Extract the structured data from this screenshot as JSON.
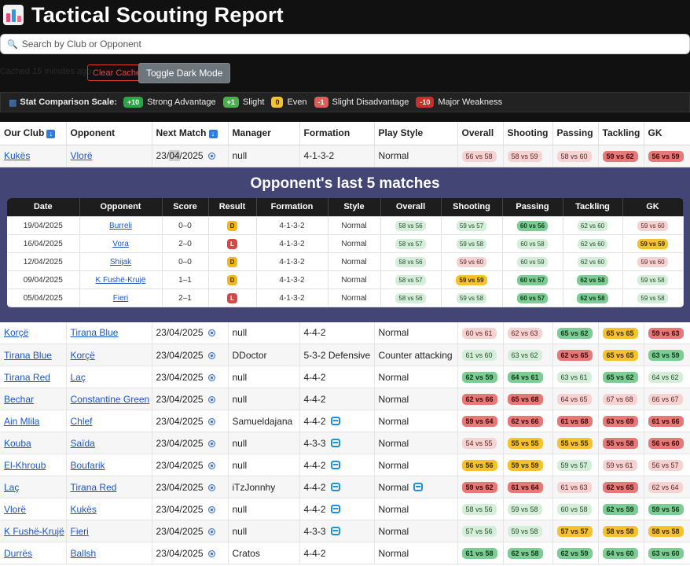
{
  "app": {
    "title": "Tactical Scouting Report",
    "search_placeholder": "Search by Club or Opponent",
    "cache_text": "Cached 15 minutes ago",
    "clear_cache_label": "Clear Cache",
    "toggle_dark_label": "Toggle Dark Mode"
  },
  "legend": {
    "label": "Stat Comparison Scale:",
    "items": [
      {
        "badge": "+10",
        "text": "Strong Advantage",
        "color": "#28a745"
      },
      {
        "badge": "+1",
        "text": "Slight",
        "color": "#4cae4c"
      },
      {
        "badge": "0",
        "text": "Even",
        "color": "#f6c22c"
      },
      {
        "badge": "-1",
        "text": "Slight Disadvantage",
        "color": "#e25b5b"
      },
      {
        "badge": "-10",
        "text": "Major Weakness",
        "color": "#c9302c"
      }
    ]
  },
  "table": {
    "headers": [
      "Our Club",
      "Opponent",
      "Next Match",
      "Manager",
      "Formation",
      "Play Style",
      "Overall",
      "Shooting",
      "Passing",
      "Tackling",
      "GK"
    ],
    "first_row": {
      "club": "Kukës",
      "opponent": "Vlorë",
      "date_a": "23/",
      "date_hl": "04",
      "date_b": "/2025",
      "manager": "null",
      "formation": "4-1-3-2",
      "style": "Normal",
      "stats": [
        {
          "t": "56 vs 58",
          "c": "p"
        },
        {
          "t": "58 vs 59",
          "c": "p"
        },
        {
          "t": "58 vs 60",
          "c": "p"
        },
        {
          "t": "59 vs 62",
          "c": "r"
        },
        {
          "t": "56 vs 59",
          "c": "r"
        }
      ]
    },
    "rows": [
      {
        "club": "Korçë",
        "opponent": "Tirana Blue",
        "date": "23/04/2025",
        "manager": "null",
        "formation": "4-4-2",
        "fswap": false,
        "style": "Normal",
        "sswap": false,
        "stats": [
          {
            "t": "60 vs 61",
            "c": "p"
          },
          {
            "t": "62 vs 63",
            "c": "p"
          },
          {
            "t": "65 vs 62",
            "c": "vg"
          },
          {
            "t": "65 vs 65",
            "c": "y"
          },
          {
            "t": "59 vs 63",
            "c": "r"
          }
        ]
      },
      {
        "club": "Tirana Blue",
        "opponent": "Korçë",
        "date": "23/04/2025",
        "manager": "DDoctor",
        "formation": "5-3-2 Defensive",
        "fswap": false,
        "style": "Counter attacking",
        "sswap": false,
        "stats": [
          {
            "t": "61 vs 60",
            "c": "g"
          },
          {
            "t": "63 vs 62",
            "c": "g"
          },
          {
            "t": "62 vs 65",
            "c": "r"
          },
          {
            "t": "65 vs 65",
            "c": "y"
          },
          {
            "t": "63 vs 59",
            "c": "vg"
          }
        ]
      },
      {
        "club": "Tirana Red",
        "opponent": "Laç",
        "date": "23/04/2025",
        "manager": "null",
        "formation": "4-4-2",
        "fswap": false,
        "style": "Normal",
        "sswap": false,
        "stats": [
          {
            "t": "62 vs 59",
            "c": "vg"
          },
          {
            "t": "64 vs 61",
            "c": "vg"
          },
          {
            "t": "63 vs 61",
            "c": "g"
          },
          {
            "t": "65 vs 62",
            "c": "vg"
          },
          {
            "t": "64 vs 62",
            "c": "g"
          }
        ]
      },
      {
        "club": "Bechar",
        "opponent": "Constantine Green",
        "date": "23/04/2025",
        "manager": "null",
        "formation": "4-4-2",
        "fswap": false,
        "style": "Normal",
        "sswap": false,
        "stats": [
          {
            "t": "62 vs 66",
            "c": "r"
          },
          {
            "t": "65 vs 68",
            "c": "r"
          },
          {
            "t": "64 vs 65",
            "c": "p"
          },
          {
            "t": "67 vs 68",
            "c": "p"
          },
          {
            "t": "66 vs 67",
            "c": "p"
          }
        ]
      },
      {
        "club": "Ain Mlila",
        "opponent": "Chlef",
        "date": "23/04/2025",
        "manager": "Samueldajana",
        "formation": "4-4-2",
        "fswap": true,
        "style": "Normal",
        "sswap": false,
        "stats": [
          {
            "t": "59 vs 64",
            "c": "r"
          },
          {
            "t": "62 vs 66",
            "c": "r"
          },
          {
            "t": "61 vs 68",
            "c": "r"
          },
          {
            "t": "63 vs 69",
            "c": "r"
          },
          {
            "t": "61 vs 66",
            "c": "r"
          }
        ]
      },
      {
        "club": "Kouba",
        "opponent": "Saïda",
        "date": "23/04/2025",
        "manager": "null",
        "formation": "4-3-3",
        "fswap": true,
        "style": "Normal",
        "sswap": false,
        "stats": [
          {
            "t": "54 vs 55",
            "c": "p"
          },
          {
            "t": "55 vs 55",
            "c": "y"
          },
          {
            "t": "55 vs 55",
            "c": "y"
          },
          {
            "t": "55 vs 58",
            "c": "r"
          },
          {
            "t": "56 vs 60",
            "c": "r"
          }
        ]
      },
      {
        "club": "El-Khroub",
        "opponent": "Boufarik",
        "date": "23/04/2025",
        "manager": "null",
        "formation": "4-4-2",
        "fswap": true,
        "style": "Normal",
        "sswap": false,
        "stats": [
          {
            "t": "56 vs 56",
            "c": "y"
          },
          {
            "t": "59 vs 59",
            "c": "y"
          },
          {
            "t": "59 vs 57",
            "c": "g"
          },
          {
            "t": "59 vs 61",
            "c": "p"
          },
          {
            "t": "56 vs 57",
            "c": "p"
          }
        ]
      },
      {
        "club": "Laç",
        "opponent": "Tirana Red",
        "date": "23/04/2025",
        "manager": "iTzJonnhy",
        "formation": "4-4-2",
        "fswap": true,
        "style": "Normal",
        "sswap": true,
        "stats": [
          {
            "t": "59 vs 62",
            "c": "r"
          },
          {
            "t": "61 vs 64",
            "c": "r"
          },
          {
            "t": "61 vs 63",
            "c": "p"
          },
          {
            "t": "62 vs 65",
            "c": "r"
          },
          {
            "t": "62 vs 64",
            "c": "p"
          }
        ]
      },
      {
        "club": "Vlorë",
        "opponent": "Kukës",
        "date": "23/04/2025",
        "manager": "null",
        "formation": "4-4-2",
        "fswap": true,
        "style": "Normal",
        "sswap": false,
        "stats": [
          {
            "t": "58 vs 56",
            "c": "g"
          },
          {
            "t": "59 vs 58",
            "c": "g"
          },
          {
            "t": "60 vs 58",
            "c": "g"
          },
          {
            "t": "62 vs 59",
            "c": "vg"
          },
          {
            "t": "59 vs 56",
            "c": "vg"
          }
        ]
      },
      {
        "club": "K Fushë-Krujë",
        "opponent": "Fieri",
        "date": "23/04/2025",
        "manager": "null",
        "formation": "4-3-3",
        "fswap": true,
        "style": "Normal",
        "sswap": false,
        "stats": [
          {
            "t": "57 vs 56",
            "c": "g"
          },
          {
            "t": "59 vs 58",
            "c": "g"
          },
          {
            "t": "57 vs 57",
            "c": "y"
          },
          {
            "t": "58 vs 58",
            "c": "y"
          },
          {
            "t": "58 vs 58",
            "c": "y"
          }
        ]
      },
      {
        "club": "Durrës",
        "opponent": "Ballsh",
        "date": "23/04/2025",
        "manager": "Cratos",
        "formation": "4-4-2",
        "fswap": false,
        "style": "Normal",
        "sswap": false,
        "stats": [
          {
            "t": "61 vs 58",
            "c": "vg"
          },
          {
            "t": "62 vs 58",
            "c": "vg"
          },
          {
            "t": "62 vs 59",
            "c": "vg"
          },
          {
            "t": "64 vs 60",
            "c": "vg"
          },
          {
            "t": "63 vs 60",
            "c": "vg"
          }
        ]
      }
    ]
  },
  "last_matches": {
    "title": "Opponent's last 5 matches",
    "headers": [
      "Date",
      "Opponent",
      "Score",
      "Result",
      "Formation",
      "Style",
      "Overall",
      "Shooting",
      "Passing",
      "Tackling",
      "GK"
    ],
    "rows": [
      {
        "date": "19/04/2025",
        "opponent": "Burreli",
        "score": "0–0",
        "result": "D",
        "formation": "4-1-3-2",
        "style": "Normal",
        "stats": [
          {
            "t": "58 vs 56",
            "c": "g"
          },
          {
            "t": "59 vs 57",
            "c": "g"
          },
          {
            "t": "60 vs 56",
            "c": "vg"
          },
          {
            "t": "62 vs 60",
            "c": "g"
          },
          {
            "t": "59 vs 60",
            "c": "p"
          }
        ]
      },
      {
        "date": "16/04/2025",
        "opponent": "Vora",
        "score": "2–0",
        "result": "L",
        "formation": "4-1-3-2",
        "style": "Normal",
        "stats": [
          {
            "t": "58 vs 57",
            "c": "g"
          },
          {
            "t": "59 vs 58",
            "c": "g"
          },
          {
            "t": "60 vs 58",
            "c": "g"
          },
          {
            "t": "62 vs 60",
            "c": "g"
          },
          {
            "t": "59 vs 59",
            "c": "y"
          }
        ]
      },
      {
        "date": "12/04/2025",
        "opponent": "Shijak",
        "score": "0–0",
        "result": "D",
        "formation": "4-1-3-2",
        "style": "Normal",
        "stats": [
          {
            "t": "58 vs 56",
            "c": "g"
          },
          {
            "t": "59 vs 60",
            "c": "p"
          },
          {
            "t": "60 vs 59",
            "c": "g"
          },
          {
            "t": "62 vs 60",
            "c": "g"
          },
          {
            "t": "59 vs 60",
            "c": "p"
          }
        ]
      },
      {
        "date": "09/04/2025",
        "opponent": "K Fushë-Krujë",
        "score": "1–1",
        "result": "D",
        "formation": "4-1-3-2",
        "style": "Normal",
        "stats": [
          {
            "t": "58 vs 57",
            "c": "g"
          },
          {
            "t": "59 vs 59",
            "c": "y"
          },
          {
            "t": "60 vs 57",
            "c": "vg"
          },
          {
            "t": "62 vs 58",
            "c": "vg"
          },
          {
            "t": "59 vs 58",
            "c": "g"
          }
        ]
      },
      {
        "date": "05/04/2025",
        "opponent": "Fieri",
        "score": "2–1",
        "result": "L",
        "formation": "4-1-3-2",
        "style": "Normal",
        "stats": [
          {
            "t": "58 vs 56",
            "c": "g"
          },
          {
            "t": "59 vs 58",
            "c": "g"
          },
          {
            "t": "60 vs 57",
            "c": "vg"
          },
          {
            "t": "62 vs 58",
            "c": "vg"
          },
          {
            "t": "59 vs 58",
            "c": "g"
          }
        ]
      }
    ]
  }
}
